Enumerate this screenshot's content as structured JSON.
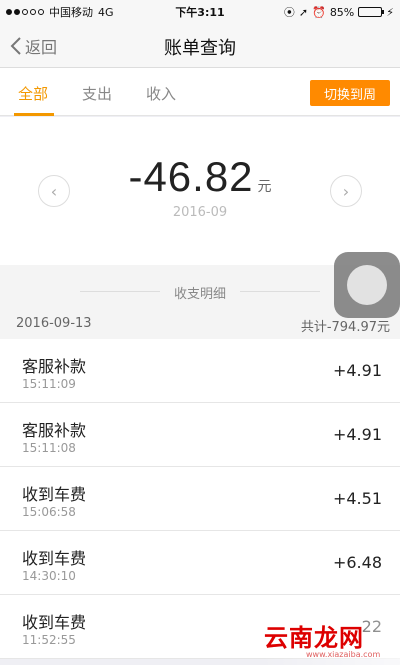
{
  "status_bar": {
    "carrier": "中国移动",
    "network": "4G",
    "time": "下午3:11",
    "battery": "85%",
    "battery_level": 0.85
  },
  "nav": {
    "back_label": "返回",
    "title": "账单查询"
  },
  "tabs": {
    "items": [
      {
        "label": "全部",
        "active": true
      },
      {
        "label": "支出",
        "active": false
      },
      {
        "label": "收入",
        "active": false
      }
    ],
    "switch_label": "切换到周"
  },
  "summary": {
    "amount": "-46.82",
    "unit": "元",
    "month": "2016-09",
    "prev_icon": "‹",
    "next_icon": "›"
  },
  "details": {
    "title": "收支明细",
    "date": "2016-09-13",
    "total": "共计-794.97元"
  },
  "records": [
    {
      "title": "客服补款",
      "time": "15:11:09",
      "amount": "+4.91"
    },
    {
      "title": "客服补款",
      "time": "15:11:08",
      "amount": "+4.91"
    },
    {
      "title": "收到车费",
      "time": "15:06:58",
      "amount": "+4.51"
    },
    {
      "title": "收到车费",
      "time": "14:30:10",
      "amount": "+6.48"
    },
    {
      "title": "收到车费",
      "time": "11:52:55",
      "amount": "22"
    }
  ],
  "watermark": {
    "text": "云南龙网",
    "small": "www.xiazaiba.com"
  },
  "colors": {
    "accent": "#f39800",
    "button": "#ff8a00"
  }
}
